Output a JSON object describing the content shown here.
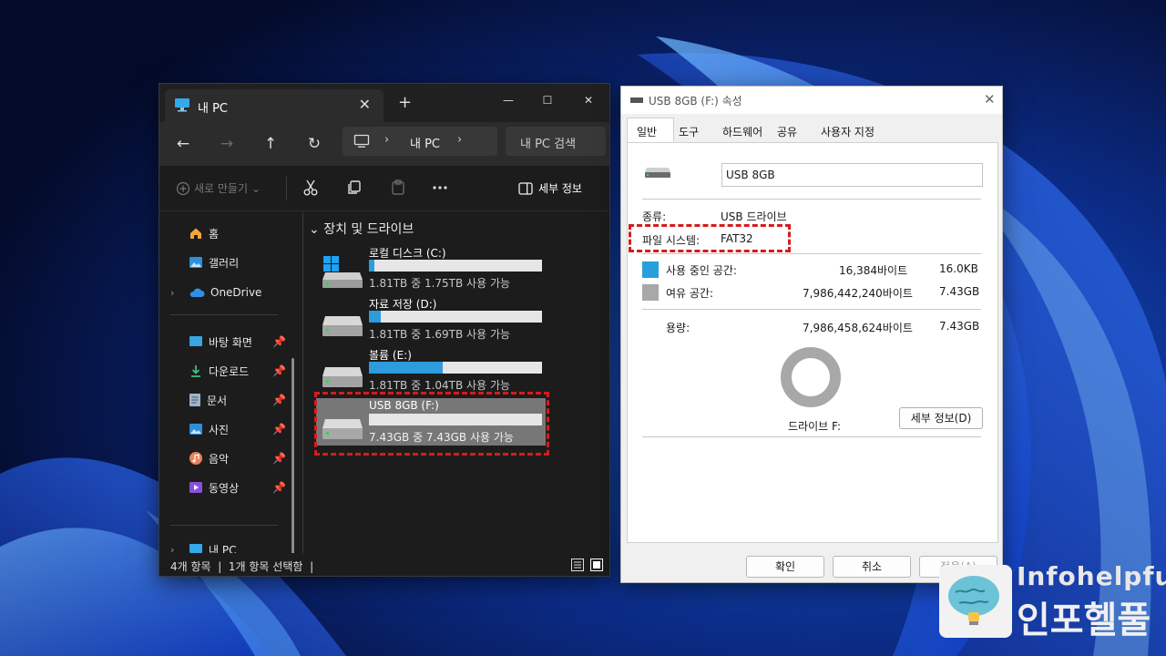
{
  "explorer": {
    "tab_title": "내 PC",
    "new_tab_glyph": "+",
    "address_text": "내 PC",
    "search_placeholder": "내 PC 검색",
    "toolbar": {
      "new_label": "새로 만들기",
      "details_label": "세부 정보"
    },
    "nav": {
      "home": "홈",
      "gallery": "갤러리",
      "onedrive": "OneDrive",
      "pinned": [
        "바탕 화면",
        "다운로드",
        "문서",
        "사진",
        "음악",
        "동영상"
      ],
      "this_pc": "내 PC"
    },
    "group_header": "장치 및 드라이브",
    "drives": [
      {
        "name": "로컬 디스크 (C:)",
        "info": "1.81TB 중 1.75TB 사용 가능",
        "used_fraction": 0.03
      },
      {
        "name": "자료 저장 (D:)",
        "info": "1.81TB 중 1.69TB 사용 가능",
        "used_fraction": 0.066
      },
      {
        "name": "볼륨 (E:)",
        "info": "1.81TB 중 1.04TB 사용 가능",
        "used_fraction": 0.425
      },
      {
        "name": "USB 8GB (F:)",
        "info": "7.43GB 중 7.43GB 사용 가능",
        "used_fraction": 0.0
      }
    ],
    "status": {
      "items": "4개 항목",
      "selected": "1개 항목 선택함"
    }
  },
  "properties": {
    "title": "USB 8GB (F:) 속성",
    "tabs": [
      "일반",
      "도구",
      "하드웨어",
      "공유",
      "사용자 지정"
    ],
    "volume_name": "USB 8GB",
    "type_label": "종류:",
    "type_value": "USB 드라이브",
    "fs_label": "파일 시스템:",
    "fs_value": "FAT32",
    "used": {
      "label": "사용 중인 공간:",
      "bytes": "16,384바이트",
      "size": "16.0KB"
    },
    "free": {
      "label": "여유 공간:",
      "bytes": "7,986,442,240바이트",
      "size": "7.43GB"
    },
    "capacity": {
      "label": "용량:",
      "bytes": "7,986,458,624바이트",
      "size": "7.43GB"
    },
    "drive_label": "드라이브 F:",
    "details_button": "세부 정보(D)",
    "ok_button": "확인",
    "cancel_button": "취소",
    "apply_button": "적용(A)"
  },
  "watermark": {
    "en": "Infohelpful",
    "ko": "인포헬풀"
  },
  "colors": {
    "accent": "#2d9bdc",
    "used": "#26a0da",
    "free": "#a8a8a8",
    "highlight": "#d41c1c"
  }
}
